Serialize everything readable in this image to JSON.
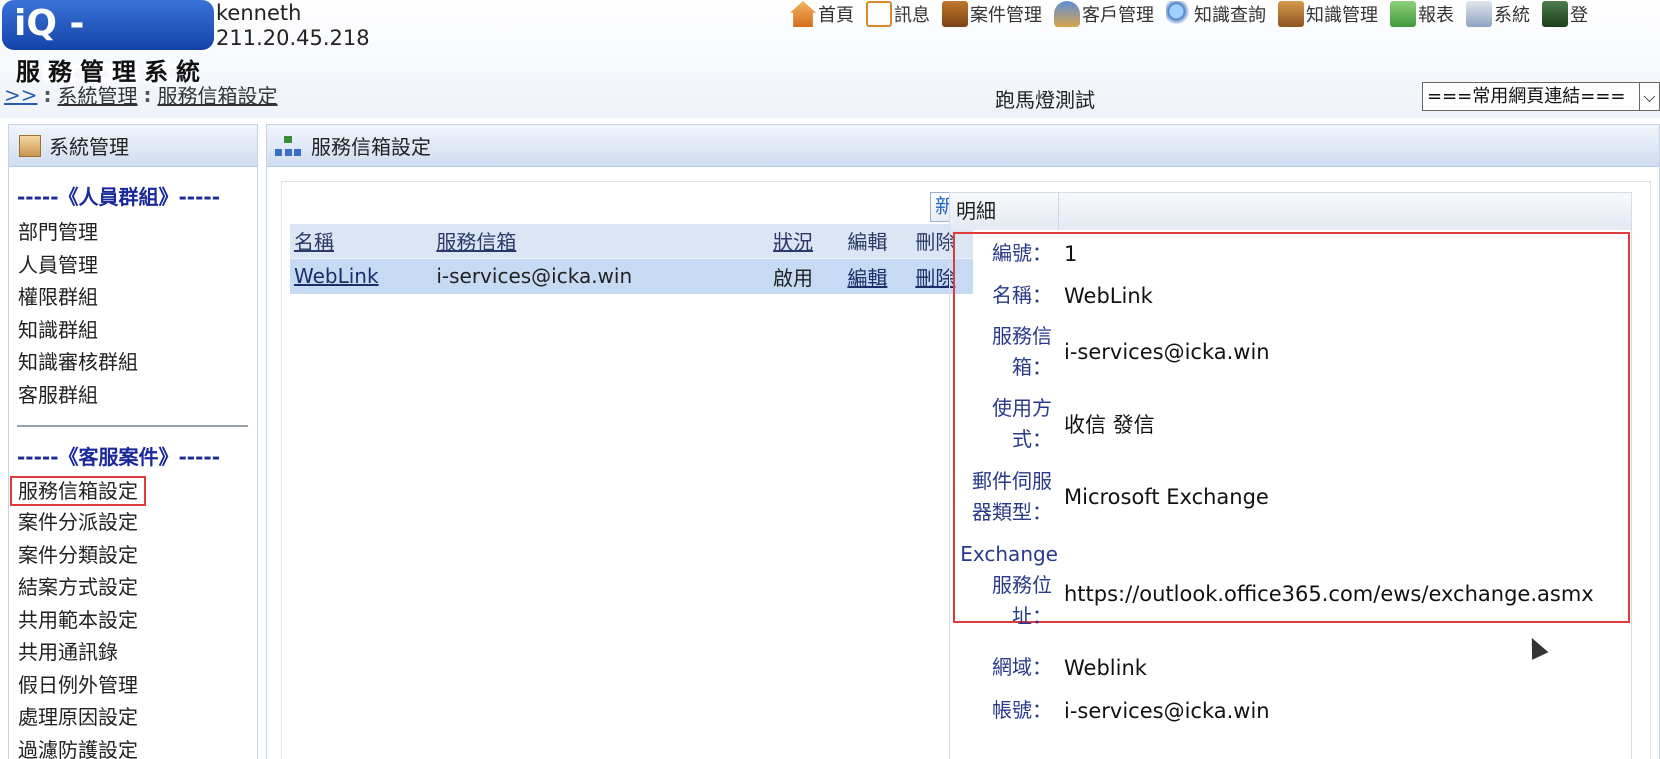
{
  "header": {
    "logo_text": "iQ - Support",
    "logo_sub": "服務管理系統",
    "user_name": "kenneth",
    "user_ip": "211.20.45.218"
  },
  "topnav": [
    {
      "label": "首頁",
      "icon": "home-icon"
    },
    {
      "label": "訊息",
      "icon": "mail-icon"
    },
    {
      "label": "案件管理",
      "icon": "case-icon"
    },
    {
      "label": "客戶管理",
      "icon": "customer-icon"
    },
    {
      "label": "知識查詢",
      "icon": "search-icon"
    },
    {
      "label": "知識管理",
      "icon": "book-icon"
    },
    {
      "label": "報表",
      "icon": "report-icon"
    },
    {
      "label": "系統",
      "icon": "system-icon"
    },
    {
      "label": "登",
      "icon": "exit-icon"
    }
  ],
  "breadcrumb": {
    "home": ">>",
    "sep": ":",
    "level1": "系統管理",
    "level2": "服務信箱設定"
  },
  "marquee": "跑馬燈測試",
  "quicklinks": {
    "selected": "===常用網頁連結==="
  },
  "sidebar": {
    "title": "系統管理",
    "group1_title": "-----《人員群組》-----",
    "group1_items": [
      "部門管理",
      "人員管理",
      "權限群組",
      "知識群組",
      "知識審核群組",
      "客服群組"
    ],
    "group2_title": "-----《客服案件》-----",
    "group2_items": [
      "服務信箱設定",
      "案件分派設定",
      "案件分類設定",
      "結案方式設定",
      "共用範本設定",
      "共用通訊錄",
      "假日例外管理",
      "處理原因設定",
      "過濾防護設定"
    ]
  },
  "main": {
    "title": "服務信箱設定",
    "add_label": "新增",
    "columns": [
      "名稱",
      "服務信箱",
      "狀況",
      "編輯",
      "刪除"
    ],
    "rows": [
      {
        "name": "WebLink",
        "mailbox": "i-services@icka.win",
        "status": "啟用",
        "edit": "編輯",
        "delete": "刪除"
      }
    ]
  },
  "detail": {
    "header": "明細",
    "fields": {
      "id_label": "編號：",
      "id_value": "1",
      "name_label": "名稱：",
      "name_value": "WebLink",
      "mailbox_label": "服務信箱：",
      "mailbox_value": "i-services@icka.win",
      "usage_label": "使用方式：",
      "usage_value": "收信 發信",
      "server_type_label": "郵件伺服器類型：",
      "server_type_value": "Microsoft Exchange",
      "exchange_url_label_en": "Exchange",
      "exchange_url_label": "服務位址：",
      "exchange_url_value": "https://outlook.office365.com/ews/exchange.asmx",
      "domain_label": "網域：",
      "domain_value": "Weblink",
      "account_label": "帳號：",
      "account_value": "i-services@icka.win"
    }
  },
  "colors": {
    "highlight_border": "#e03a3a",
    "label_color": "#2a3a8a",
    "group_title_color": "#1a2a9a"
  }
}
